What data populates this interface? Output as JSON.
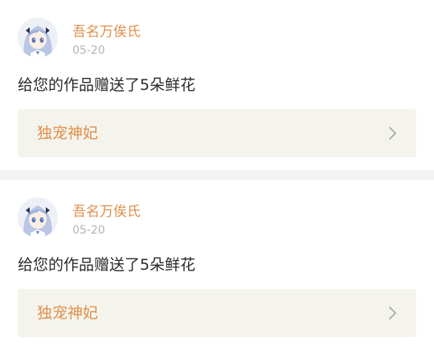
{
  "notifications": [
    {
      "username": "吾名万俟氏",
      "date": "05-20",
      "message": "给您的作品赠送了5朵鲜花",
      "work_title": "独宠神妃",
      "avatar_icon": "anime-girl-avatar",
      "chevron_icon": "chevron-right-icon"
    },
    {
      "username": "吾名万俟氏",
      "date": "05-20",
      "message": "给您的作品赠送了5朵鲜花",
      "work_title": "独宠神妃",
      "avatar_icon": "anime-girl-avatar",
      "chevron_icon": "chevron-right-icon"
    }
  ],
  "colors": {
    "username": "#e08f4b",
    "date": "#b4b4b4",
    "message": "#2a2a2a",
    "work_link_bg": "#f4f4ec",
    "separator": "#f3f3f3"
  }
}
